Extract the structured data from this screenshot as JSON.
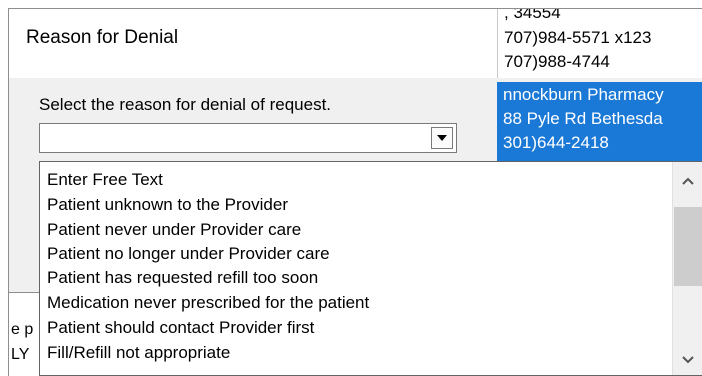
{
  "dialog": {
    "title": "Reason for Denial",
    "prompt": "Select the reason for denial of request.",
    "select_value": ""
  },
  "options": [
    "Enter Free Text",
    "Patient unknown to the Provider",
    "Patient never under Provider care",
    "Patient no longer under Provider care",
    "Patient has requested refill too soon",
    "Medication never prescribed for the patient",
    "Patient should contact Provider first",
    "Fill/Refill not appropriate"
  ],
  "background_info": {
    "white_lines": [
      ", 34554",
      "707)984-5571  x123",
      "707)988-4744"
    ],
    "blue_lines": [
      "nnockburn Pharmacy",
      "88 Pyle Rd Bethesda",
      "301)644-2418"
    ],
    "left_fragments": [
      "e p",
      "LY"
    ]
  },
  "colors": {
    "selection_blue": "#1a78d6",
    "dialog_bg": "#f0f0f0"
  }
}
